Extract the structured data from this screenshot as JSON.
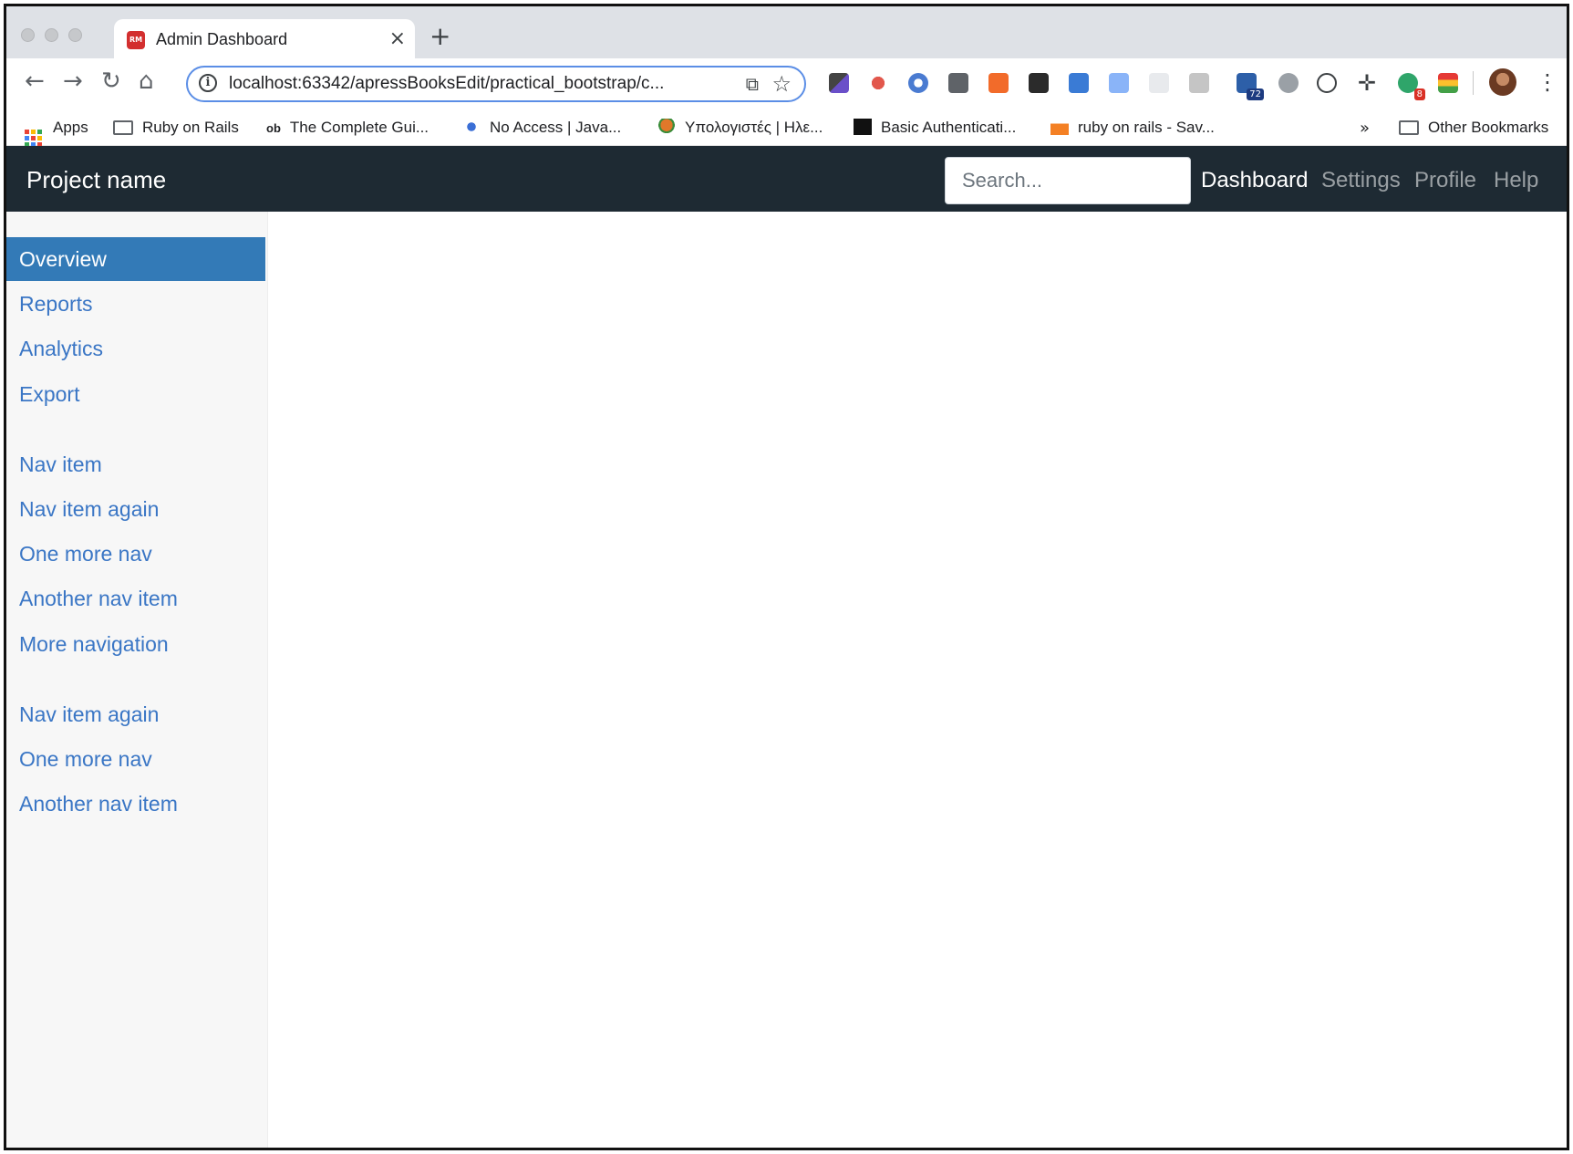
{
  "browser": {
    "tab_title": "Admin Dashboard",
    "tab_favicon_text": "RM",
    "tab_close": "×",
    "new_tab": "+",
    "url": "localhost:63342/apressBooksEdit/practical_bootstrap/c...",
    "extension_badges": {
      "ext_72": "72",
      "ext_8": "8"
    },
    "bookmarks": [
      "Apps",
      "Ruby on Rails",
      "The Complete Gui...",
      "No Access | Java...",
      "Υπολογιστές | Ηλε...",
      "Basic Authenticati...",
      "ruby on rails - Sav..."
    ],
    "bookmarks_overflow": "»",
    "other_bookmarks": "Other Bookmarks",
    "ob_icon_text": "ob"
  },
  "navbar": {
    "brand": "Project name",
    "search_placeholder": "Search...",
    "links": [
      "Dashboard",
      "Settings",
      "Profile",
      "Help"
    ],
    "active_link": "Dashboard"
  },
  "sidebar": {
    "group1": [
      "Overview",
      "Reports",
      "Analytics",
      "Export"
    ],
    "group2": [
      "Nav item",
      "Nav item again",
      "One more nav",
      "Another nav item",
      "More navigation"
    ],
    "group3": [
      "Nav item again",
      "One more nav",
      "Another nav item"
    ],
    "active_item": "Overview"
  },
  "colors": {
    "navbar_bg": "#1e2a33",
    "sidebar_bg": "#f7f7f7",
    "active_bg": "#337ab7",
    "link": "#3a76c5"
  }
}
